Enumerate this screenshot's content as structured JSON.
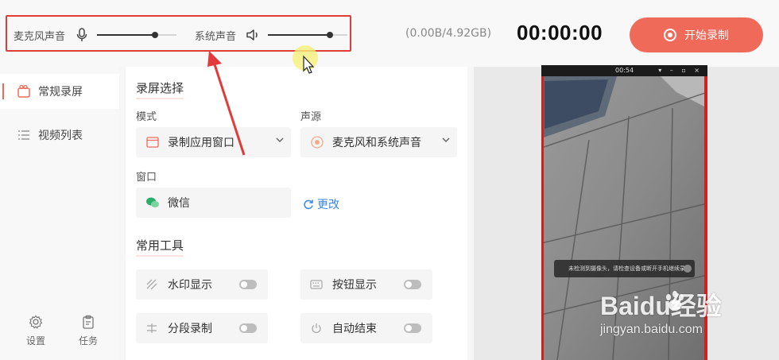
{
  "header": {
    "mic_label": "麦克风声音",
    "mic_level": 0.73,
    "system_label": "系统声音",
    "system_level": 0.78,
    "storage": "(0.00B/4.92GB)",
    "timer": "00:00:00",
    "record_button": "开始录制",
    "accent_color": "#f06a5a"
  },
  "sidebar": {
    "items": [
      {
        "label": "常规录屏",
        "icon": "record-screen-icon",
        "active": true
      },
      {
        "label": "视频列表",
        "icon": "list-icon",
        "active": false
      }
    ],
    "bottom": [
      {
        "label": "设置",
        "icon": "gear-icon"
      },
      {
        "label": "任务",
        "icon": "clipboard-icon"
      }
    ]
  },
  "main": {
    "section_record": "录屏选择",
    "mode_label": "模式",
    "mode_value": "录制应用窗口",
    "source_label": "声源",
    "source_value": "麦克风和系统声音",
    "window_label": "窗口",
    "window_value": "微信",
    "change_link": "更改",
    "section_tools": "常用工具",
    "tools": [
      {
        "label": "水印显示",
        "icon": "watermark-icon",
        "on": false
      },
      {
        "label": "按钮显示",
        "icon": "keyboard-icon",
        "on": false
      },
      {
        "label": "分段录制",
        "icon": "segment-icon",
        "on": false
      },
      {
        "label": "自动结束",
        "icon": "power-icon",
        "on": false
      }
    ]
  },
  "preview": {
    "window_time": "00:54",
    "notice_text": "未检测到摄像头，请检查设备或断开手机继续录制"
  },
  "watermark": {
    "brand": "Baidu经验",
    "url": "jingyan.baidu.com"
  }
}
